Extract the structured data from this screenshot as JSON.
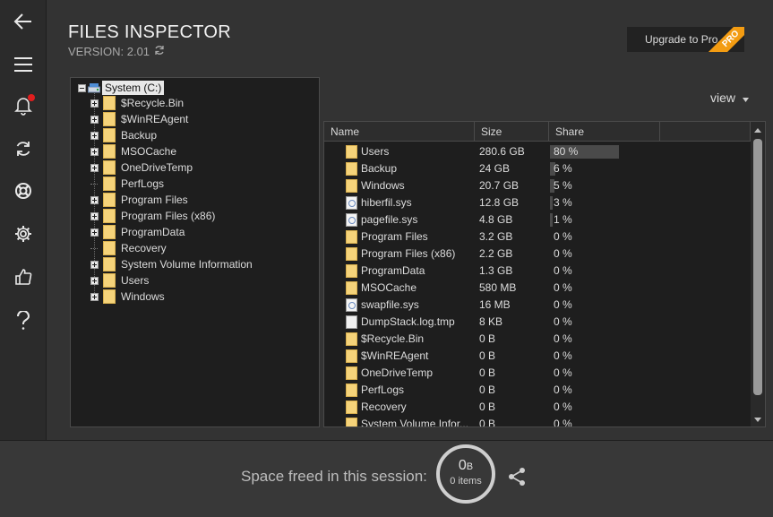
{
  "app": {
    "title": "FILES INSPECTOR",
    "version": "VERSION: 2.01"
  },
  "upgrade": {
    "label": "Upgrade to Pro",
    "badge": "PRO"
  },
  "sidebar": {
    "items": [
      {
        "icon": "back-arrow-icon"
      },
      {
        "icon": "menu-icon"
      },
      {
        "icon": "bell-icon",
        "has_notification": true
      },
      {
        "icon": "refresh-icon"
      },
      {
        "icon": "lifebuoy-icon"
      },
      {
        "icon": "gear-icon"
      },
      {
        "icon": "thumbs-up-icon"
      },
      {
        "icon": "help-icon"
      }
    ]
  },
  "tree": {
    "root": "System (C:)",
    "items": [
      {
        "label": "$Recycle.Bin",
        "expandable": true
      },
      {
        "label": "$WinREAgent",
        "expandable": true
      },
      {
        "label": "Backup",
        "expandable": true
      },
      {
        "label": "MSOCache",
        "expandable": true
      },
      {
        "label": "OneDriveTemp",
        "expandable": true
      },
      {
        "label": "PerfLogs",
        "expandable": false
      },
      {
        "label": "Program Files",
        "expandable": true
      },
      {
        "label": "Program Files (x86)",
        "expandable": true
      },
      {
        "label": "ProgramData",
        "expandable": true
      },
      {
        "label": "Recovery",
        "expandable": false
      },
      {
        "label": "System Volume Information",
        "expandable": true
      },
      {
        "label": "Users",
        "expandable": true
      },
      {
        "label": "Windows",
        "expandable": true
      }
    ]
  },
  "view": {
    "label": "view"
  },
  "table": {
    "columns": [
      "Name",
      "Size",
      "Share"
    ],
    "rows": [
      {
        "name": "Users",
        "type": "folder",
        "size": "280.6 GB",
        "share": "80 %",
        "share_value": 80
      },
      {
        "name": "Backup",
        "type": "folder",
        "size": "24 GB",
        "share": "6 %",
        "share_value": 6
      },
      {
        "name": "Windows",
        "type": "folder",
        "size": "20.7 GB",
        "share": "5 %",
        "share_value": 5
      },
      {
        "name": "hiberfil.sys",
        "type": "sysfile",
        "size": "12.8 GB",
        "share": "3 %",
        "share_value": 3
      },
      {
        "name": "pagefile.sys",
        "type": "sysfile",
        "size": "4.8 GB",
        "share": "1 %",
        "share_value": 1
      },
      {
        "name": "Program Files",
        "type": "folder",
        "size": "3.2 GB",
        "share": "0 %",
        "share_value": 0
      },
      {
        "name": "Program Files (x86)",
        "type": "folder",
        "size": "2.2 GB",
        "share": "0 %",
        "share_value": 0
      },
      {
        "name": "ProgramData",
        "type": "folder",
        "size": "1.3 GB",
        "share": "0 %",
        "share_value": 0
      },
      {
        "name": "MSOCache",
        "type": "folder",
        "size": "580 MB",
        "share": "0 %",
        "share_value": 0
      },
      {
        "name": "swapfile.sys",
        "type": "sysfile",
        "size": "16 MB",
        "share": "0 %",
        "share_value": 0
      },
      {
        "name": "DumpStack.log.tmp",
        "type": "file",
        "size": "8 KB",
        "share": "0 %",
        "share_value": 0
      },
      {
        "name": "$Recycle.Bin",
        "type": "folder",
        "size": "0 B",
        "share": "0 %",
        "share_value": 0
      },
      {
        "name": "$WinREAgent",
        "type": "folder",
        "size": "0 B",
        "share": "0 %",
        "share_value": 0
      },
      {
        "name": "OneDriveTemp",
        "type": "folder",
        "size": "0 B",
        "share": "0 %",
        "share_value": 0
      },
      {
        "name": "PerfLogs",
        "type": "folder",
        "size": "0 B",
        "share": "0 %",
        "share_value": 0
      },
      {
        "name": "Recovery",
        "type": "folder",
        "size": "0 B",
        "share": "0 %",
        "share_value": 0
      },
      {
        "name": "System Volume Infor...",
        "type": "folder",
        "size": "0 B",
        "share": "0 %",
        "share_value": 0
      }
    ]
  },
  "footer": {
    "freed_label": "Space freed in this session:",
    "freed_value": "0",
    "freed_unit": "B",
    "freed_items": "0 items"
  },
  "colors": {
    "accent": "#f39c12",
    "notification": "#e01e1e",
    "folder": "#f5d37a"
  }
}
